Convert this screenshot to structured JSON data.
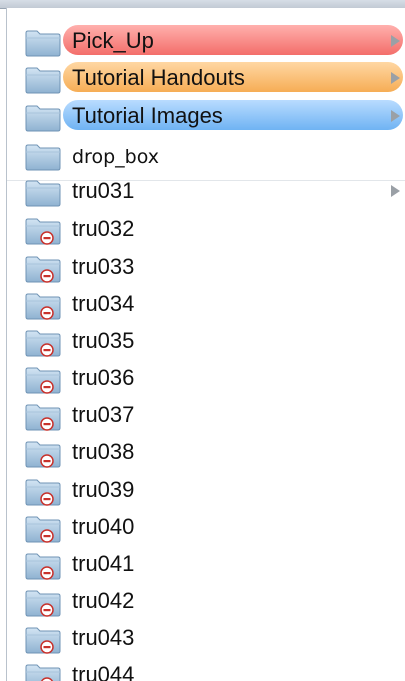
{
  "items": [
    {
      "label": "Pick_Up",
      "icon": "folder-icon",
      "tag": "red",
      "arrow": true
    },
    {
      "label": "Tutorial Handouts",
      "icon": "folder-icon",
      "tag": "orange",
      "arrow": true
    },
    {
      "label": "Tutorial Images",
      "icon": "folder-icon",
      "tag": "blue",
      "arrow": true
    },
    {
      "label": "drop_box",
      "icon": "folder-icon",
      "tag": "none",
      "arrow": false
    },
    {
      "label": "tru031",
      "icon": "folder-icon",
      "tag": "none",
      "arrow": true
    },
    {
      "label": "tru032",
      "icon": "restricted-folder-icon",
      "tag": "none",
      "arrow": false
    },
    {
      "label": "tru033",
      "icon": "restricted-folder-icon",
      "tag": "none",
      "arrow": false
    },
    {
      "label": "tru034",
      "icon": "restricted-folder-icon",
      "tag": "none",
      "arrow": false
    },
    {
      "label": "tru035",
      "icon": "restricted-folder-icon",
      "tag": "none",
      "arrow": false
    },
    {
      "label": "tru036",
      "icon": "restricted-folder-icon",
      "tag": "none",
      "arrow": false
    },
    {
      "label": "tru037",
      "icon": "restricted-folder-icon",
      "tag": "none",
      "arrow": false
    },
    {
      "label": "tru038",
      "icon": "restricted-folder-icon",
      "tag": "none",
      "arrow": false
    },
    {
      "label": "tru039",
      "icon": "restricted-folder-icon",
      "tag": "none",
      "arrow": false
    },
    {
      "label": "tru040",
      "icon": "restricted-folder-icon",
      "tag": "none",
      "arrow": false
    },
    {
      "label": "tru041",
      "icon": "restricted-folder-icon",
      "tag": "none",
      "arrow": false
    },
    {
      "label": "tru042",
      "icon": "restricted-folder-icon",
      "tag": "none",
      "arrow": false
    },
    {
      "label": "tru043",
      "icon": "restricted-folder-icon",
      "tag": "none",
      "arrow": false
    },
    {
      "label": "tru044",
      "icon": "restricted-folder-icon",
      "tag": "none",
      "arrow": false
    }
  ]
}
